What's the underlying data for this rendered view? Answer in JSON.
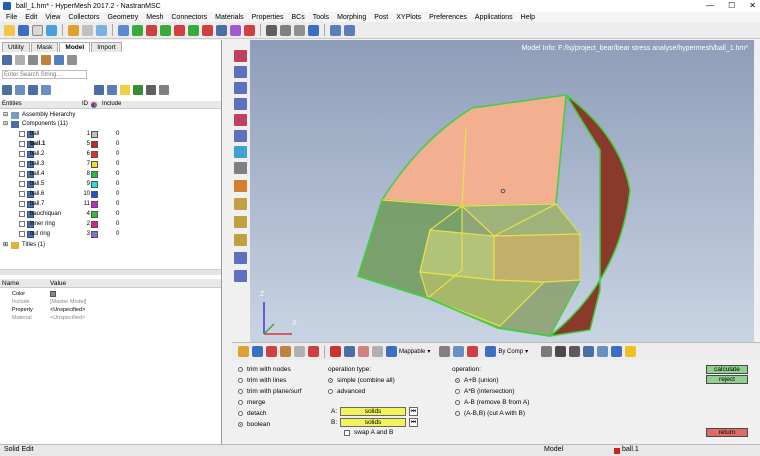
{
  "window": {
    "title": "ball_1.hm* - HyperMesh 2017.2 - NastranMSC"
  },
  "menu": [
    "File",
    "Edit",
    "View",
    "Collectors",
    "Geometry",
    "Mesh",
    "Connectors",
    "Materials",
    "Properties",
    "BCs",
    "Tools",
    "Morphing",
    "Post",
    "XYPlots",
    "Preferences",
    "Applications",
    "Help"
  ],
  "tabs": [
    "Utility",
    "Mask",
    "Model",
    "Import"
  ],
  "search": {
    "placeholder": "Enter Search String..."
  },
  "entities": {
    "header": {
      "name": "Entities",
      "id": "ID",
      "include": "Include"
    },
    "assembly": "Assembly Hierarchy",
    "components_label": "Components (11)",
    "components": [
      {
        "name": "ball",
        "id": "1",
        "color": "#c0c0c0",
        "include": "0"
      },
      {
        "name": "ball.1",
        "id": "5",
        "color": "#d02020",
        "include": "0"
      },
      {
        "name": "ball.2",
        "id": "6",
        "color": "#e63030",
        "include": "0"
      },
      {
        "name": "ball.3",
        "id": "7",
        "color": "#f0e020",
        "include": "0"
      },
      {
        "name": "ball.4",
        "id": "8",
        "color": "#20c040",
        "include": "0"
      },
      {
        "name": "ball.5",
        "id": "9",
        "color": "#20e0e0",
        "include": "0"
      },
      {
        "name": "ball.6",
        "id": "10",
        "color": "#2050e0",
        "include": "0"
      },
      {
        "name": "ball.7",
        "id": "11",
        "color": "#d020d0",
        "include": "0"
      },
      {
        "name": "baochiquan",
        "id": "4",
        "color": "#30c030",
        "include": "0"
      },
      {
        "name": "inner ring",
        "id": "2",
        "color": "#e02080",
        "include": "0"
      },
      {
        "name": "out ring",
        "id": "3",
        "color": "#8070d0",
        "include": "0"
      }
    ],
    "titles_label": "Titles (1)"
  },
  "properties": {
    "header": {
      "name": "Name",
      "value": "Value"
    },
    "rows": [
      {
        "name": "Color",
        "value": ""
      },
      {
        "name": "Include",
        "value": "[Master Model]"
      },
      {
        "name": "Property",
        "value": "<Unspecified>"
      },
      {
        "name": "Material",
        "value": "<Unspecified>"
      }
    ]
  },
  "viewport": {
    "model_info": "Model Info: F:/lsj/project_bear/bear stress analyse/hypermesh/ball_1.hm*",
    "axis_z": "Z",
    "axis_x": "X"
  },
  "bottom_toolbar": {
    "mappable": "Mappable",
    "by_comp": "By Comp"
  },
  "panel": {
    "left_options": [
      "trim with nodes",
      "trim with lines",
      "trim with plane/surf",
      "merge",
      "detach",
      "boolean"
    ],
    "selected_left": "boolean",
    "operation_type_label": "operation type:",
    "operation_types": [
      "simple (combine all)",
      "advanced"
    ],
    "operation_label": "operation:",
    "operations": [
      "A+B (union)",
      "A*B (intersection)",
      "A-B (remove B from A)",
      "(A-B,B) (cut A with B)"
    ],
    "a_label": "A:",
    "b_label": "B:",
    "a_value": "solids",
    "b_value": "solids",
    "swap_label": "swap A and B",
    "calculate": "calculate",
    "reject": "reject",
    "return": "return"
  },
  "status": {
    "left": "Solid Edit",
    "model": "Model",
    "component": "ball.1"
  },
  "colors": {
    "viewport_top": "#8e9db9",
    "viewport_bottom": "#c9d4e3",
    "solid_field": "#f2f25a",
    "green_btn": "#8fd08c",
    "return_btn": "#e26a64"
  }
}
